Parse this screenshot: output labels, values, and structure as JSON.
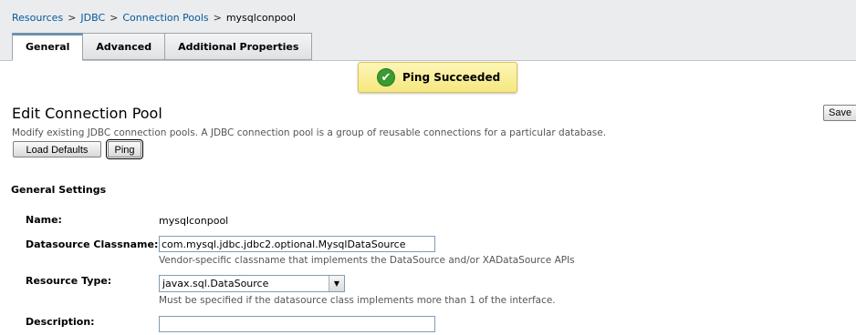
{
  "breadcrumb": {
    "items": [
      "Resources",
      "JDBC",
      "Connection Pools"
    ],
    "separator": ">",
    "current": "mysqlconpool"
  },
  "tabs": [
    {
      "label": "General",
      "active": true
    },
    {
      "label": "Advanced",
      "active": false
    },
    {
      "label": "Additional Properties",
      "active": false
    }
  ],
  "message": {
    "text": "Ping Succeeded",
    "icon": "check-circle-icon",
    "color": "#3a9b31"
  },
  "page": {
    "title": "Edit Connection Pool",
    "help": "Modify existing JDBC connection pools. A JDBC connection pool is a group of reusable connections for a particular database.",
    "save_label": "Save"
  },
  "buttons": {
    "load_defaults": "Load Defaults",
    "ping": "Ping"
  },
  "section": {
    "title": "General Settings"
  },
  "fields": {
    "name": {
      "label": "Name:",
      "value": "mysqlconpool"
    },
    "datasource_classname": {
      "label": "Datasource Classname:",
      "required_marker": "*",
      "value": "com.mysql.jdbc.jdbc2.optional.MysqlDataSource",
      "help": "Vendor-specific classname that implements the DataSource and/or XADataSource APIs"
    },
    "resource_type": {
      "label": "Resource Type:",
      "value": "javax.sql.DataSource",
      "help": "Must be specified if the datasource class implements more than 1 of the interface."
    },
    "description": {
      "label": "Description:",
      "value": ""
    }
  }
}
